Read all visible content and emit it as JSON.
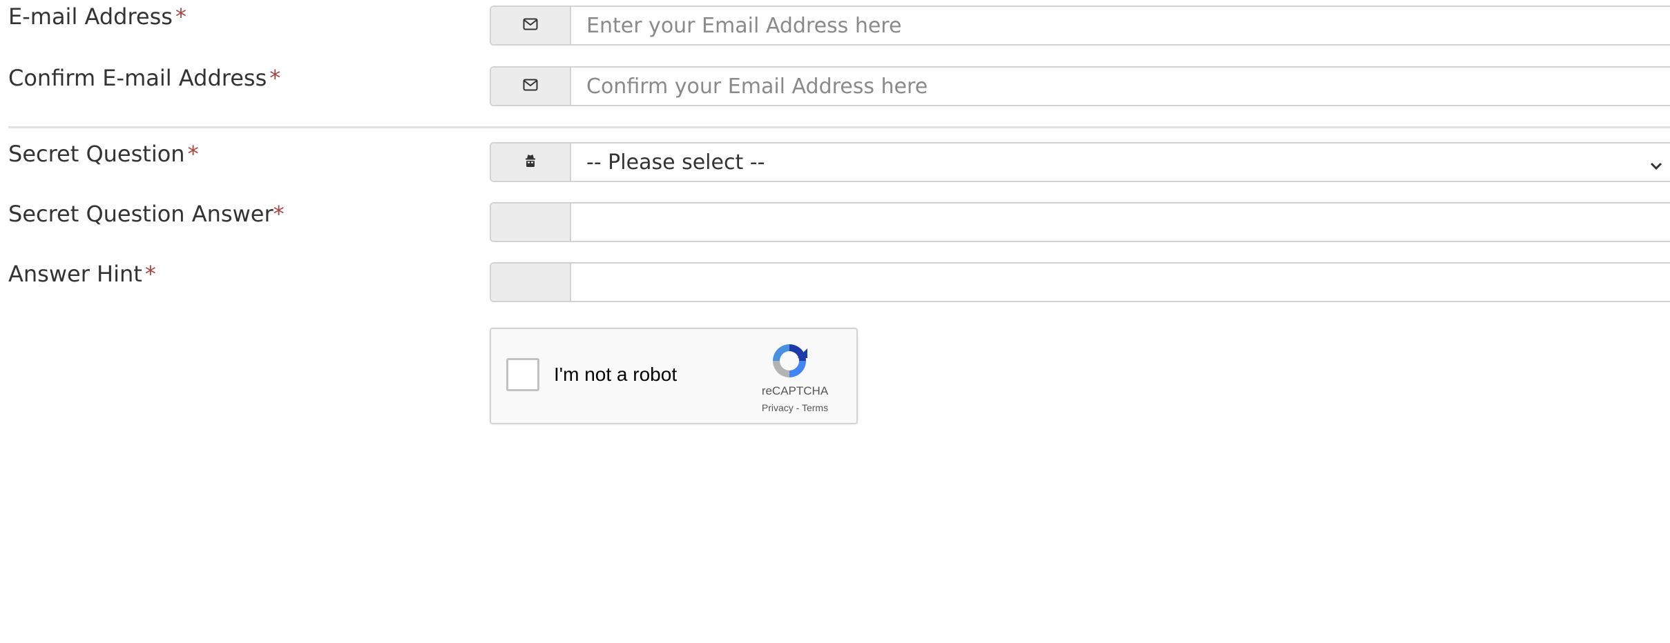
{
  "fields": {
    "email": {
      "label": "E-mail Address",
      "required_mark": "*",
      "icon": "envelope-icon",
      "placeholder": "Enter your Email Address here",
      "value": ""
    },
    "confirm_email": {
      "label": "Confirm E-mail Address",
      "required_mark": "*",
      "icon": "envelope-icon",
      "placeholder": "Confirm your Email Address here",
      "value": ""
    },
    "secret_question": {
      "label": "Secret Question",
      "required_mark": "*",
      "icon": "user-secret-icon",
      "selected": "-- Please select --"
    },
    "secret_answer": {
      "label": "Secret Question Answer",
      "required_mark": "*",
      "value": ""
    },
    "answer_hint": {
      "label": "Answer Hint",
      "required_mark": "*",
      "value": ""
    }
  },
  "captcha": {
    "label": "I'm not a robot",
    "brand": "reCAPTCHA",
    "links": "Privacy - Terms",
    "checked": false
  },
  "colors": {
    "required": "#a94442",
    "addon_bg": "#ececec",
    "border": "#d2d2d2",
    "placeholder": "#8a8a8a"
  }
}
